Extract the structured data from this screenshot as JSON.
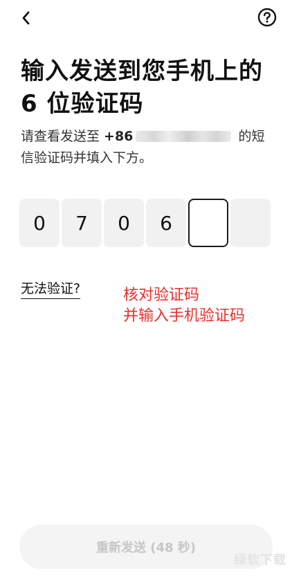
{
  "header": {
    "back_icon": "chevron-left-icon",
    "help_icon": "question-circle-icon"
  },
  "title": "输入发送到您手机上的 6 位验证码",
  "description": {
    "before": "请查看发送至 ",
    "phone_prefix": "+86",
    "after": " 的短信验证码并填入下方。"
  },
  "code_inputs": [
    "0",
    "7",
    "0",
    "6",
    "",
    ""
  ],
  "active_index": 4,
  "cant_verify_link": "无法验证?",
  "annotation": {
    "line1": "核对验证码",
    "line2": "并输入手机验证码",
    "color": "#e8302c"
  },
  "resend_button": "重新发送 (48 秒)",
  "watermark": "绿软下载"
}
